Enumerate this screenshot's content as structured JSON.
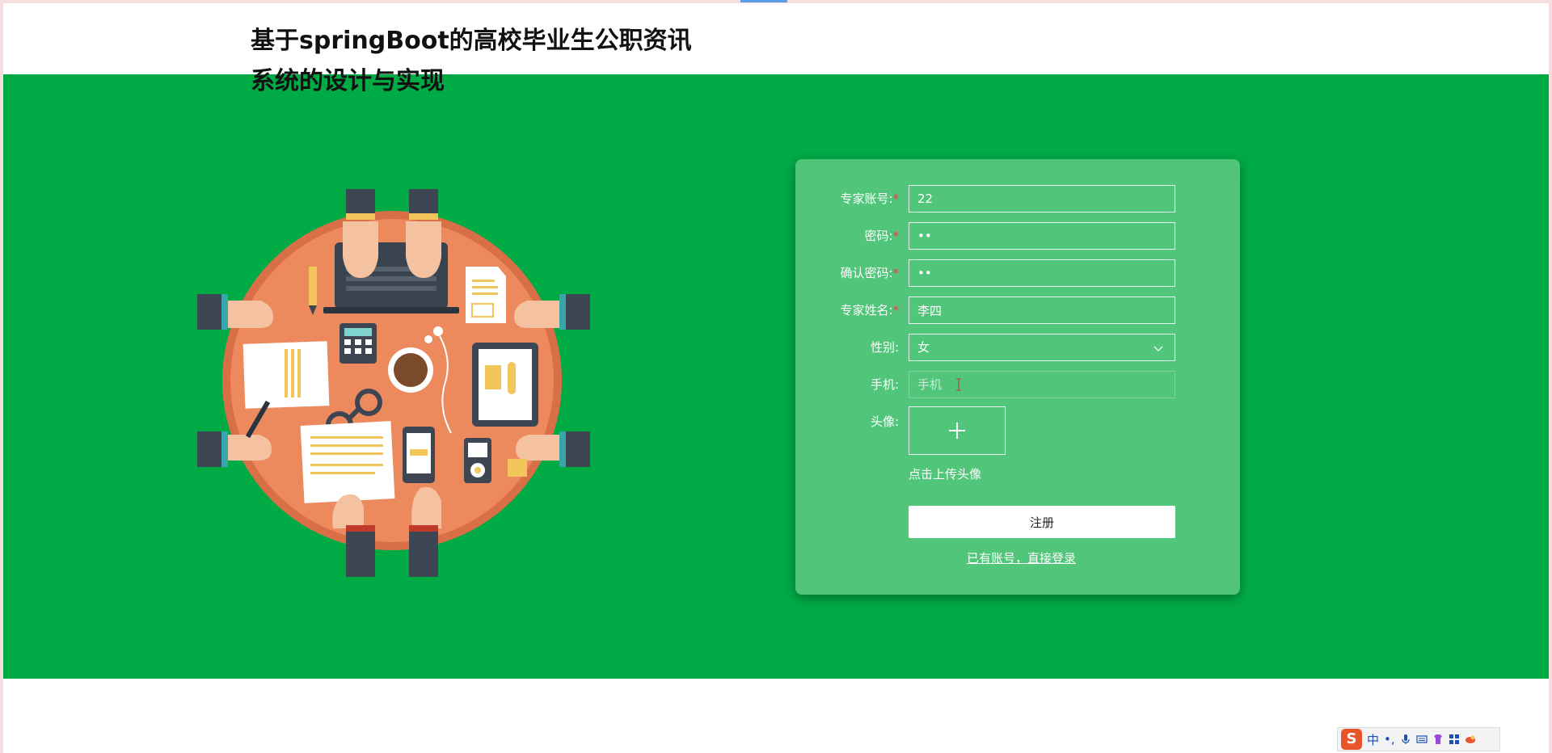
{
  "site": {
    "title": "基于springBoot的高校毕业生公职资讯系统的设计与实现"
  },
  "form": {
    "fields": [
      {
        "label": "专家账号:",
        "required": true,
        "value": "22",
        "type": "text"
      },
      {
        "label": "密码:",
        "required": true,
        "value": "••",
        "type": "password"
      },
      {
        "label": "确认密码:",
        "required": true,
        "value": "••",
        "type": "password"
      },
      {
        "label": "专家姓名:",
        "required": true,
        "value": "李四",
        "type": "text"
      },
      {
        "label": "性别:",
        "required": false,
        "value": "女",
        "type": "select"
      },
      {
        "label": "手机:",
        "required": false,
        "value": "",
        "placeholder": "手机",
        "type": "text"
      }
    ],
    "avatar_label": "头像:",
    "upload_hint": "点击上传头像",
    "submit_label": "注册",
    "login_link": "已有账号，直接登录"
  },
  "ime": {
    "logo": "S",
    "mode": "中",
    "punct": "•,"
  },
  "colors": {
    "hero_bg": "#00ab45",
    "card_bg": "#51c57a",
    "required": "#e04444",
    "illustration_table": "#ec8a5e"
  }
}
